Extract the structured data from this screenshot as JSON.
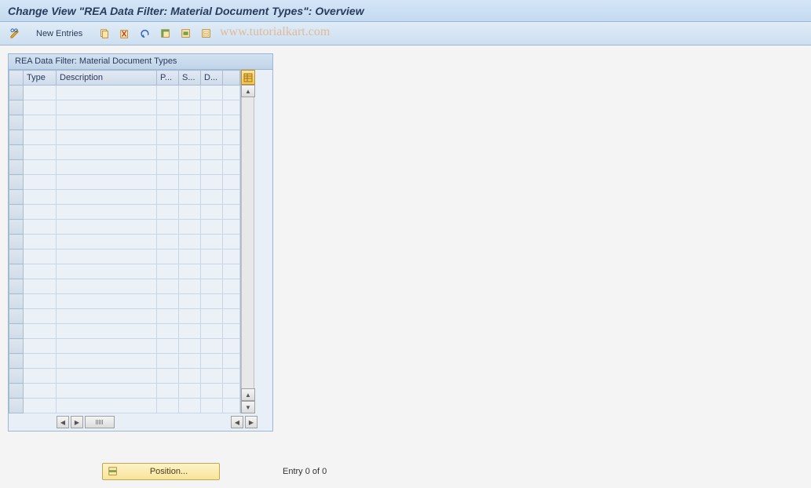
{
  "title": "Change View \"REA Data Filter: Material Document Types\": Overview",
  "toolbar": {
    "new_entries_label": "New Entries"
  },
  "watermark": "www.tutorialkart.com",
  "panel": {
    "title": "REA Data Filter: Material Document Types",
    "columns": {
      "type": "Type",
      "description": "Description",
      "p": "P...",
      "s": "S...",
      "d": "D..."
    },
    "rows": [
      {},
      {},
      {},
      {},
      {},
      {},
      {},
      {},
      {},
      {},
      {},
      {},
      {},
      {},
      {},
      {},
      {},
      {},
      {},
      {},
      {},
      {}
    ]
  },
  "footer": {
    "position_label": "Position...",
    "entry_label": "Entry 0 of 0"
  }
}
